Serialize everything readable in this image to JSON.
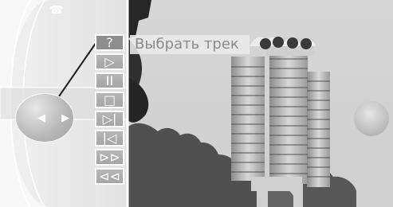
{
  "tooltip": {
    "text": "Выбрать трек"
  },
  "controls": {
    "buttons": [
      {
        "label": "?",
        "name": "help-button",
        "selected": true
      },
      {
        "label": "▷",
        "name": "play-button",
        "selected": false
      },
      {
        "label": "II",
        "name": "pause-button",
        "selected": false
      },
      {
        "label": "□",
        "name": "stop-button",
        "selected": false
      },
      {
        "label": "▷|",
        "name": "next-track-button",
        "selected": false
      },
      {
        "label": "|◁",
        "name": "previous-track-button",
        "selected": false
      },
      {
        "label": "⊳⊳",
        "name": "fast-forward-button",
        "selected": false
      },
      {
        "label": "⊲⊲",
        "name": "rewind-button",
        "selected": false
      }
    ]
  },
  "controller": {
    "left_arrow": "◀",
    "right_arrow": "▶"
  },
  "icons": {
    "phone": "phone-icon"
  }
}
